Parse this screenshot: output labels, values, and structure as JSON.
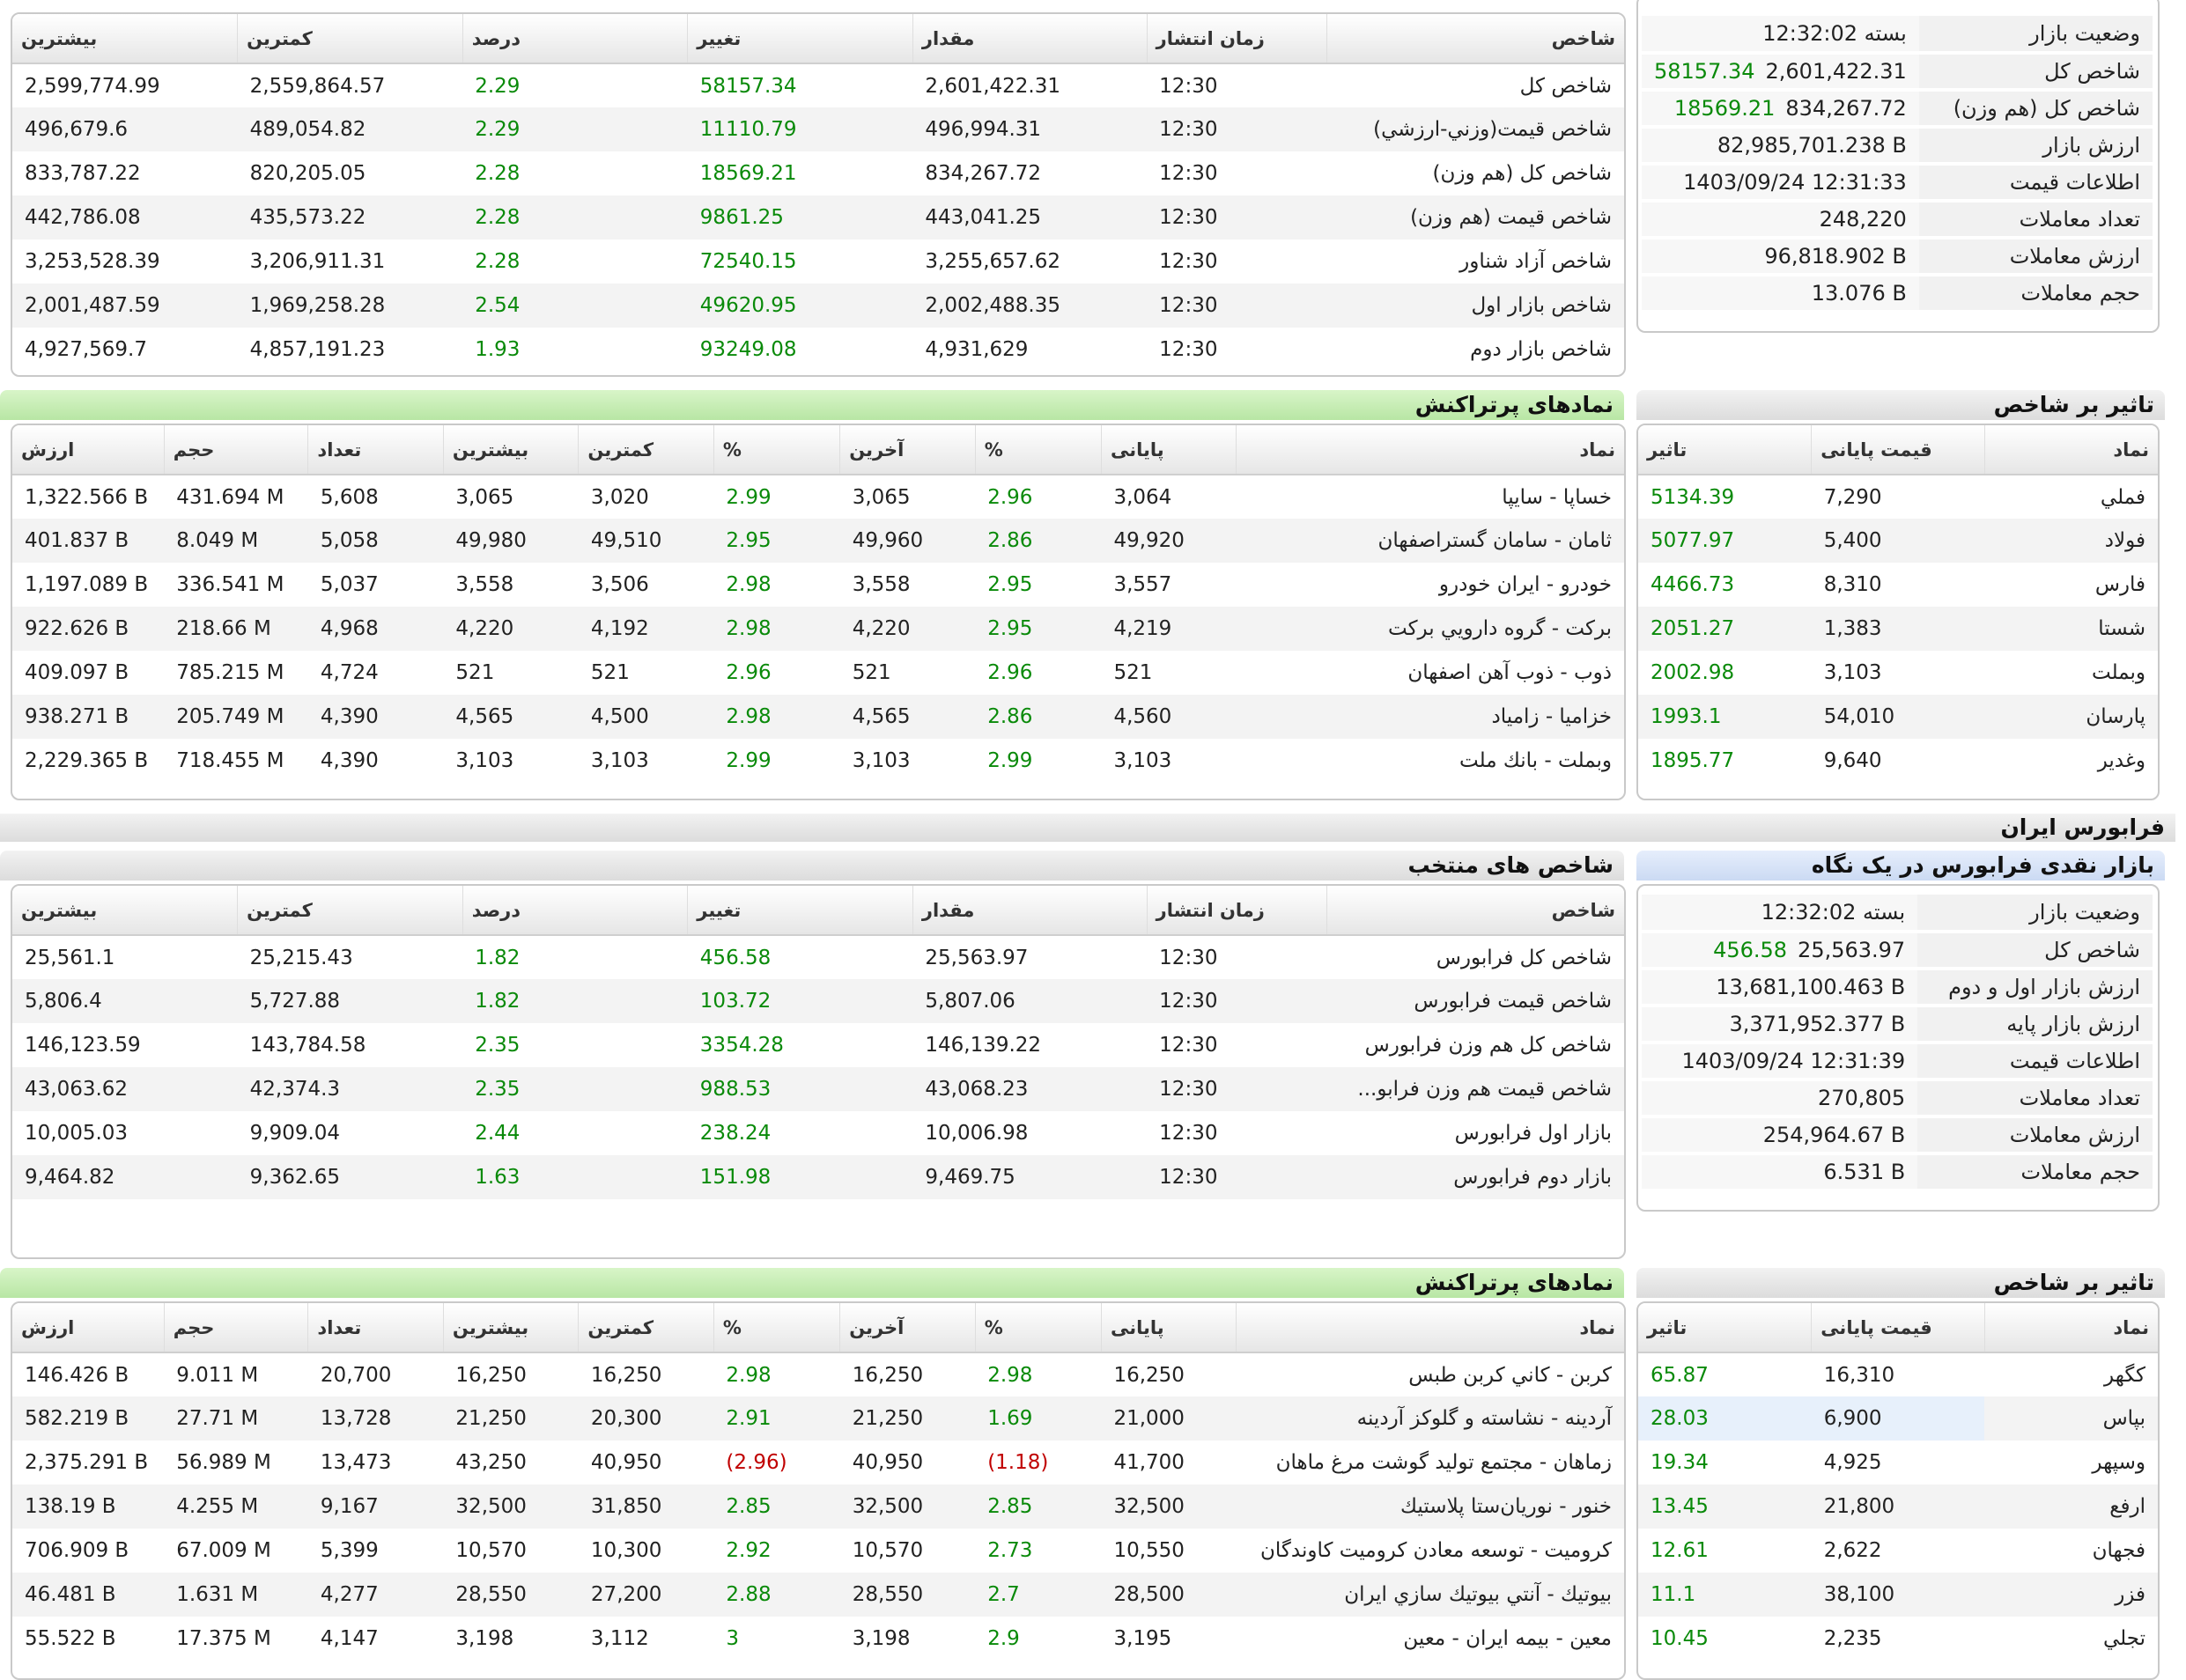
{
  "tse": {
    "indices": {
      "headers": [
        "شاخص",
        "زمان انتشار",
        "مقدار",
        "تغییر",
        "درصد",
        "کمترین",
        "بیشترین"
      ],
      "rows": [
        [
          "شاخص كل",
          "12:30",
          "2,601,422.31",
          "58157.34",
          "2.29",
          "2,559,864.57",
          "2,599,774.99"
        ],
        [
          "شاخص قيمت(وزني-ارزشي)",
          "12:30",
          "496,994.31",
          "11110.79",
          "2.29",
          "489,054.82",
          "496,679.6"
        ],
        [
          "شاخص كل (هم وزن)",
          "12:30",
          "834,267.72",
          "18569.21",
          "2.28",
          "820,205.05",
          "833,787.22"
        ],
        [
          "شاخص قيمت (هم وزن)",
          "12:30",
          "443,041.25",
          "9861.25",
          "2.28",
          "435,573.22",
          "442,786.08"
        ],
        [
          "شاخص آزاد شناور",
          "12:30",
          "3,255,657.62",
          "72540.15",
          "2.28",
          "3,206,911.31",
          "3,253,528.39"
        ],
        [
          "شاخص بازار اول",
          "12:30",
          "2,002,488.35",
          "49620.95",
          "2.54",
          "1,969,258.28",
          "2,001,487.59"
        ],
        [
          "شاخص بازار دوم",
          "12:30",
          "4,931,629",
          "93249.08",
          "1.93",
          "4,857,191.23",
          "4,927,569.7"
        ]
      ]
    },
    "summary": {
      "rows": [
        {
          "label": "وضعيت بازار",
          "value": "بسته 12:32:02",
          "extra": ""
        },
        {
          "label": "شاخص كل",
          "value": "2,601,422.31",
          "extra": "58157.34"
        },
        {
          "label": "شاخص كل (هم وزن)",
          "value": "834,267.72",
          "extra": "18569.21"
        },
        {
          "label": "ارزش بازار",
          "value": "82,985,701.238 B",
          "extra": ""
        },
        {
          "label": "اطلاعات قيمت",
          "value": "1403/09/24 12:31:33",
          "extra": ""
        },
        {
          "label": "تعداد معاملات",
          "value": "248,220",
          "extra": ""
        },
        {
          "label": "ارزش معاملات",
          "value": "96,818.902 B",
          "extra": ""
        },
        {
          "label": "حجم معاملات",
          "value": "13.076 B",
          "extra": ""
        }
      ]
    },
    "active_title": "نمادهای پرتراکنش",
    "active": {
      "headers": [
        "نماد",
        "پایانی",
        "%",
        "آخرین",
        "%",
        "کمترین",
        "بیشترین",
        "تعداد",
        "حجم",
        "ارزش"
      ],
      "rows": [
        [
          "خساپا - سايپا",
          "3,064",
          "2.96",
          "3,065",
          "2.99",
          "3,020",
          "3,065",
          "5,608",
          "431.694 M",
          "1,322.566 B"
        ],
        [
          "ثامان - سامان گستراصفهان",
          "49,920",
          "2.86",
          "49,960",
          "2.95",
          "49,510",
          "49,980",
          "5,058",
          "8.049 M",
          "401.837 B"
        ],
        [
          "خودرو - ايران خودرو",
          "3,557",
          "2.95",
          "3,558",
          "2.98",
          "3,506",
          "3,558",
          "5,037",
          "336.541 M",
          "1,197.089 B"
        ],
        [
          "بركت - گروه دارويي بركت",
          "4,219",
          "2.95",
          "4,220",
          "2.98",
          "4,192",
          "4,220",
          "4,968",
          "218.66 M",
          "922.626 B"
        ],
        [
          "ذوب - ذوب آهن اصفهان",
          "521",
          "2.96",
          "521",
          "2.96",
          "521",
          "521",
          "4,724",
          "785.215 M",
          "409.097 B"
        ],
        [
          "خزاميا - زامياد",
          "4,560",
          "2.86",
          "4,565",
          "2.98",
          "4,500",
          "4,565",
          "4,390",
          "205.749 M",
          "938.271 B"
        ],
        [
          "وبملت - بانك ملت",
          "3,103",
          "2.99",
          "3,103",
          "2.99",
          "3,103",
          "3,103",
          "4,390",
          "718.455 M",
          "2,229.365 B"
        ]
      ]
    },
    "impact_title": "تاثیر بر شاخص",
    "impact": {
      "headers": [
        "نماد",
        "قیمت پایانی",
        "تاثیر"
      ],
      "rows": [
        [
          "فملي",
          "7,290",
          "5134.39"
        ],
        [
          "فولاد",
          "5,400",
          "5077.97"
        ],
        [
          "فارس",
          "8,310",
          "4466.73"
        ],
        [
          "شستا",
          "1,383",
          "2051.27"
        ],
        [
          "وبملت",
          "3,103",
          "2002.98"
        ],
        [
          "پارسان",
          "54,010",
          "1993.1"
        ],
        [
          "وغدير",
          "9,640",
          "1895.77"
        ]
      ]
    }
  },
  "ifb": {
    "section_title": "فرابورس ایران",
    "summary_title": "بازار نقدی فرابورس در یک نگاه",
    "indices_title": "شاخص های منتخب",
    "indices": {
      "headers": [
        "شاخص",
        "زمان انتشار",
        "مقدار",
        "تغییر",
        "درصد",
        "کمترین",
        "بیشترین"
      ],
      "rows": [
        [
          "شاخص كل فرابورس",
          "12:30",
          "25,563.97",
          "456.58",
          "1.82",
          "25,215.43",
          "25,561.1"
        ],
        [
          "شاخص قيمت فرابورس",
          "12:30",
          "5,807.06",
          "103.72",
          "1.82",
          "5,727.88",
          "5,806.4"
        ],
        [
          "شاخص كل هم وزن فرابورس",
          "12:30",
          "146,139.22",
          "3354.28",
          "2.35",
          "143,784.58",
          "146,123.59"
        ],
        [
          "شاخص قيمت هم وزن فرابو...",
          "12:30",
          "43,068.23",
          "988.53",
          "2.35",
          "42,374.3",
          "43,063.62"
        ],
        [
          "بازار اول فرابورس",
          "12:30",
          "10,006.98",
          "238.24",
          "2.44",
          "9,909.04",
          "10,005.03"
        ],
        [
          "بازار دوم فرابورس",
          "12:30",
          "9,469.75",
          "151.98",
          "1.63",
          "9,362.65",
          "9,464.82"
        ]
      ]
    },
    "summary": {
      "rows": [
        {
          "label": "وضعيت بازار",
          "value": "بسته 12:32:02",
          "extra": ""
        },
        {
          "label": "شاخص كل",
          "value": "25,563.97",
          "extra": "456.58"
        },
        {
          "label": "ارزش بازار اول و دوم",
          "value": "13,681,100.463 B",
          "extra": ""
        },
        {
          "label": "ارزش بازار پايه",
          "value": "3,371,952.377 B",
          "extra": ""
        },
        {
          "label": "اطلاعات قيمت",
          "value": "1403/09/24 12:31:39",
          "extra": ""
        },
        {
          "label": "تعداد معاملات",
          "value": "270,805",
          "extra": ""
        },
        {
          "label": "ارزش معاملات",
          "value": "254,964.67 B",
          "extra": ""
        },
        {
          "label": "حجم معاملات",
          "value": "6.531 B",
          "extra": ""
        }
      ]
    },
    "active_title": "نمادهای پرتراکنش",
    "active": {
      "headers": [
        "نماد",
        "پایانی",
        "%",
        "آخرین",
        "%",
        "کمترین",
        "بیشترین",
        "تعداد",
        "حجم",
        "ارزش"
      ],
      "rows": [
        [
          "كربن - كاني كربن طبس",
          "16,250",
          "2.98",
          "16,250",
          "2.98",
          "16,250",
          "16,250",
          "20,700",
          "9.011 M",
          "146.426 B"
        ],
        [
          "آردينه - نشاسته و گلوكز آردينه",
          "21,000",
          "1.69",
          "21,250",
          "2.91",
          "20,300",
          "21,250",
          "13,728",
          "27.71 M",
          "582.219 B"
        ],
        [
          "زماهان - مجتمع توليد گوشت مرغ ماهان",
          "41,700",
          "(1.18)",
          "40,950",
          "(2.96)",
          "40,950",
          "43,250",
          "13,473",
          "56.989 M",
          "2,375.291 B"
        ],
        [
          "خنور - نوريان‌ستا پلاستيك",
          "32,500",
          "2.85",
          "32,500",
          "2.85",
          "31,850",
          "32,500",
          "9,167",
          "4.255 M",
          "138.19 B"
        ],
        [
          "كروميت - توسعه معادن كروميت كاوندگان",
          "10,550",
          "2.73",
          "10,570",
          "2.92",
          "10,300",
          "10,570",
          "5,399",
          "67.009 M",
          "706.909 B"
        ],
        [
          "بيوتيك - آنتي بيوتيك سازي ايران",
          "28,500",
          "2.7",
          "28,550",
          "2.88",
          "27,200",
          "28,550",
          "4,277",
          "1.631 M",
          "46.481 B"
        ],
        [
          "معين - بيمه ايران - معين",
          "3,195",
          "2.9",
          "3,198",
          "3",
          "3,112",
          "3,198",
          "4,147",
          "17.375 M",
          "55.522 B"
        ]
      ]
    },
    "impact_title": "تاثیر بر شاخص",
    "impact": {
      "headers": [
        "نماد",
        "قیمت پایانی",
        "تاثیر"
      ],
      "rows": [
        [
          "كگهر",
          "16,310",
          "65.87"
        ],
        [
          "بپاس",
          "6,900",
          "28.03"
        ],
        [
          "وسپهر",
          "4,925",
          "19.34"
        ],
        [
          "ارفع",
          "21,800",
          "13.45"
        ],
        [
          "فجهان",
          "2,622",
          "12.61"
        ],
        [
          "فزر",
          "38,100",
          "11.1"
        ],
        [
          "تجلي",
          "2,235",
          "10.45"
        ]
      ]
    }
  },
  "colors": {
    "positive": "#0a8a0a",
    "negative": "#c00000",
    "green_bar": "#c6edb4",
    "blue_bar": "#d5e2f8"
  }
}
